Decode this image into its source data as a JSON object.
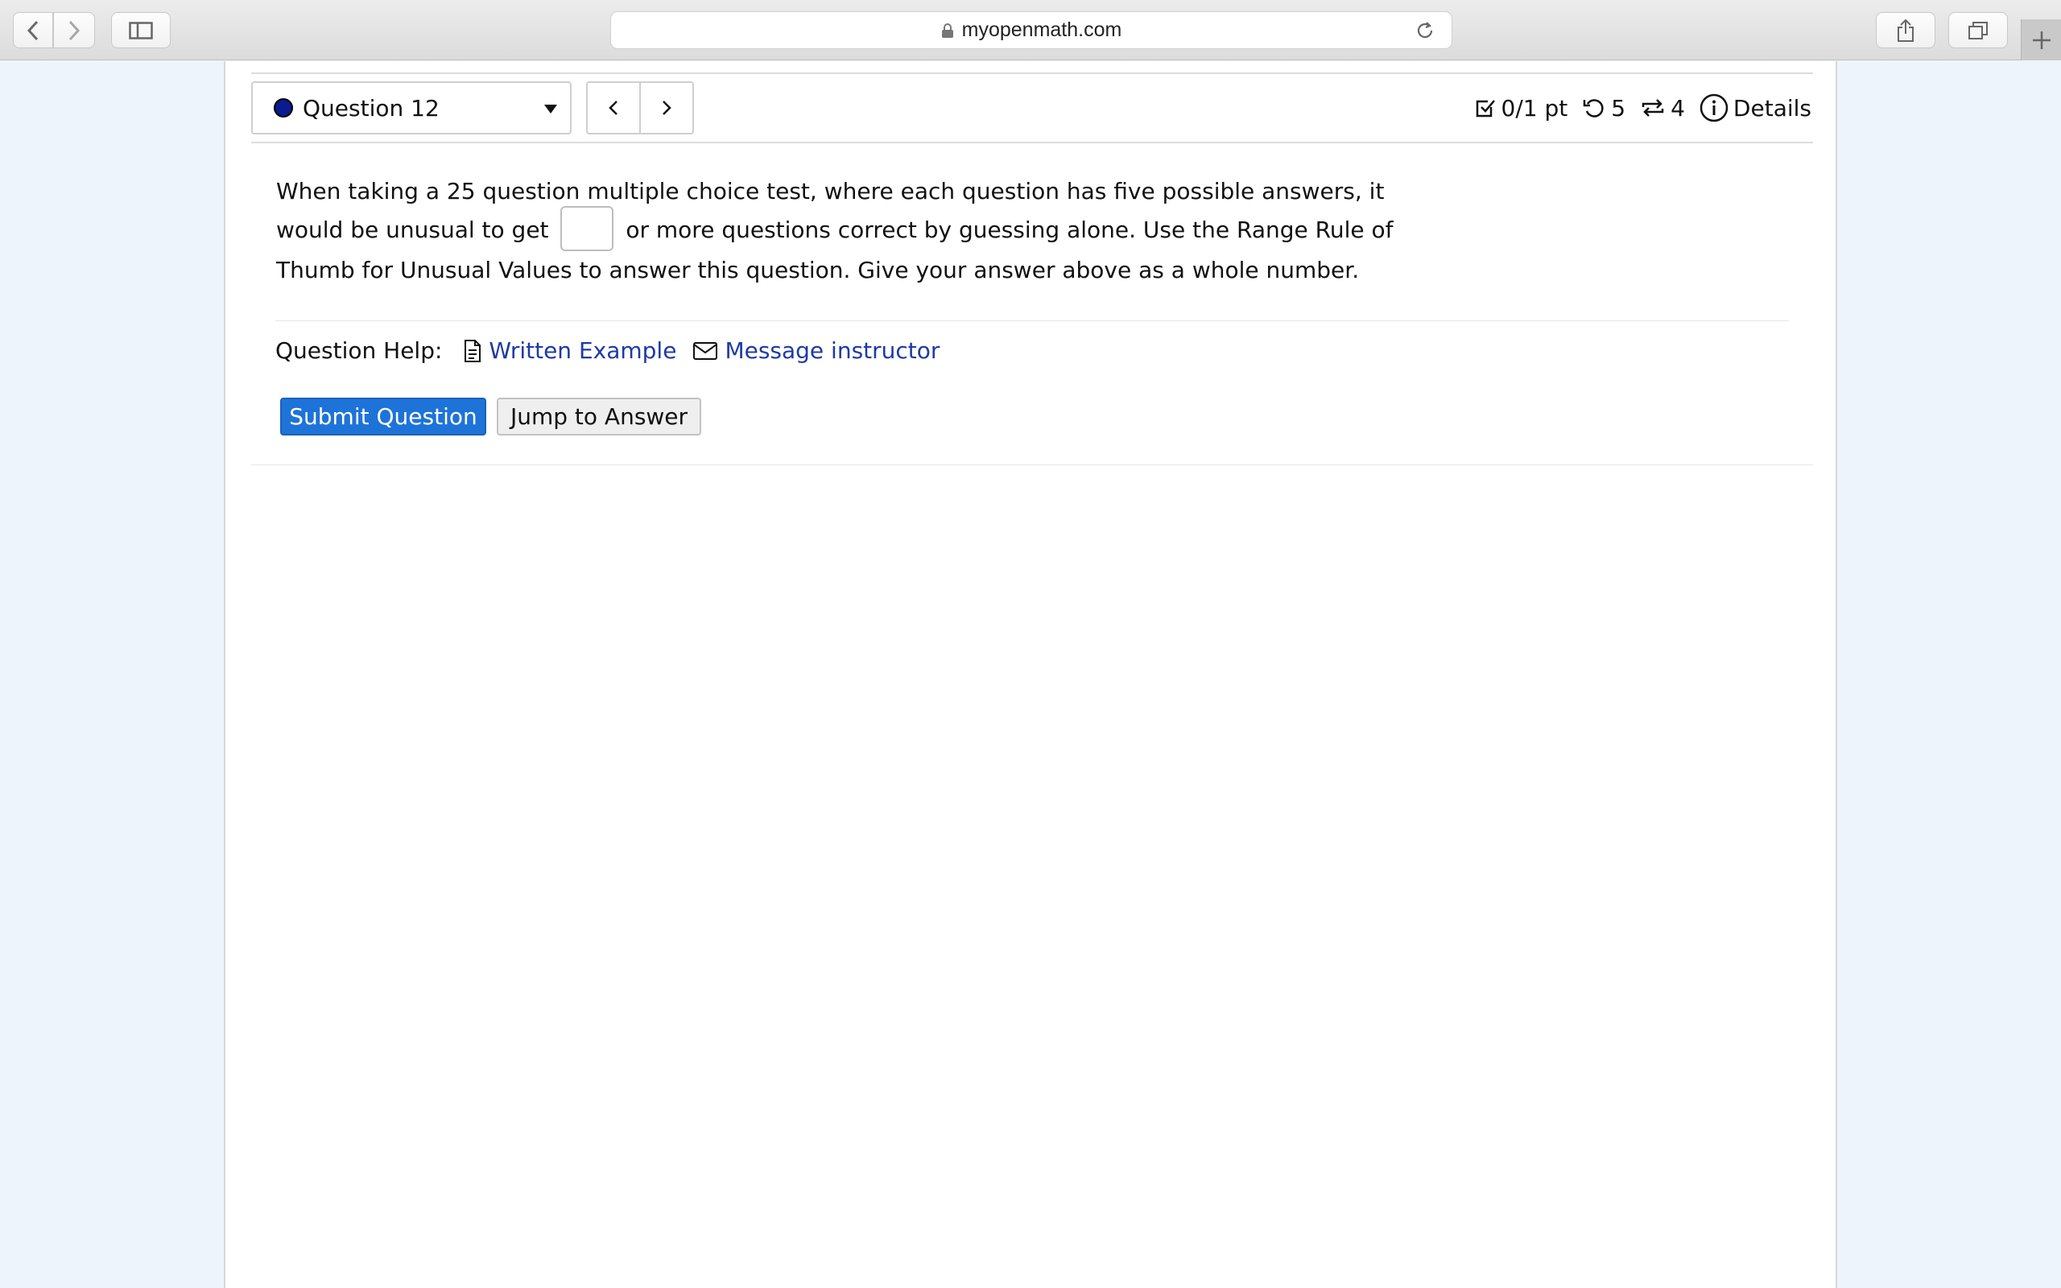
{
  "browser": {
    "url": "myopenmath.com",
    "icons": [
      "chevron-left-icon",
      "chevron-right-icon",
      "sidebar-icon",
      "lock-icon",
      "reload-icon",
      "share-icon",
      "tabs-icon",
      "plus-icon"
    ]
  },
  "question_nav": {
    "label": "Question 12",
    "status_color": "#0a1a8f"
  },
  "stats": {
    "score": "0/1 pt",
    "retries": "5",
    "regens": "4",
    "details": "Details"
  },
  "question": {
    "part1": "When taking a 25 question multiple choice test, where each question has five possible answers, it would be unusual to get",
    "answer_value": "",
    "part2": "or more questions correct by guessing alone. Use the Range Rule of Thumb for Unusual Values to answer this question. Give your answer above as a whole number."
  },
  "help": {
    "label": "Question Help:",
    "written_example": "Written Example",
    "message_instructor": "Message instructor"
  },
  "buttons": {
    "submit": "Submit Question",
    "jump": "Jump to Answer"
  },
  "colors": {
    "primary": "#1e73d8",
    "link": "#1d3aa6"
  }
}
